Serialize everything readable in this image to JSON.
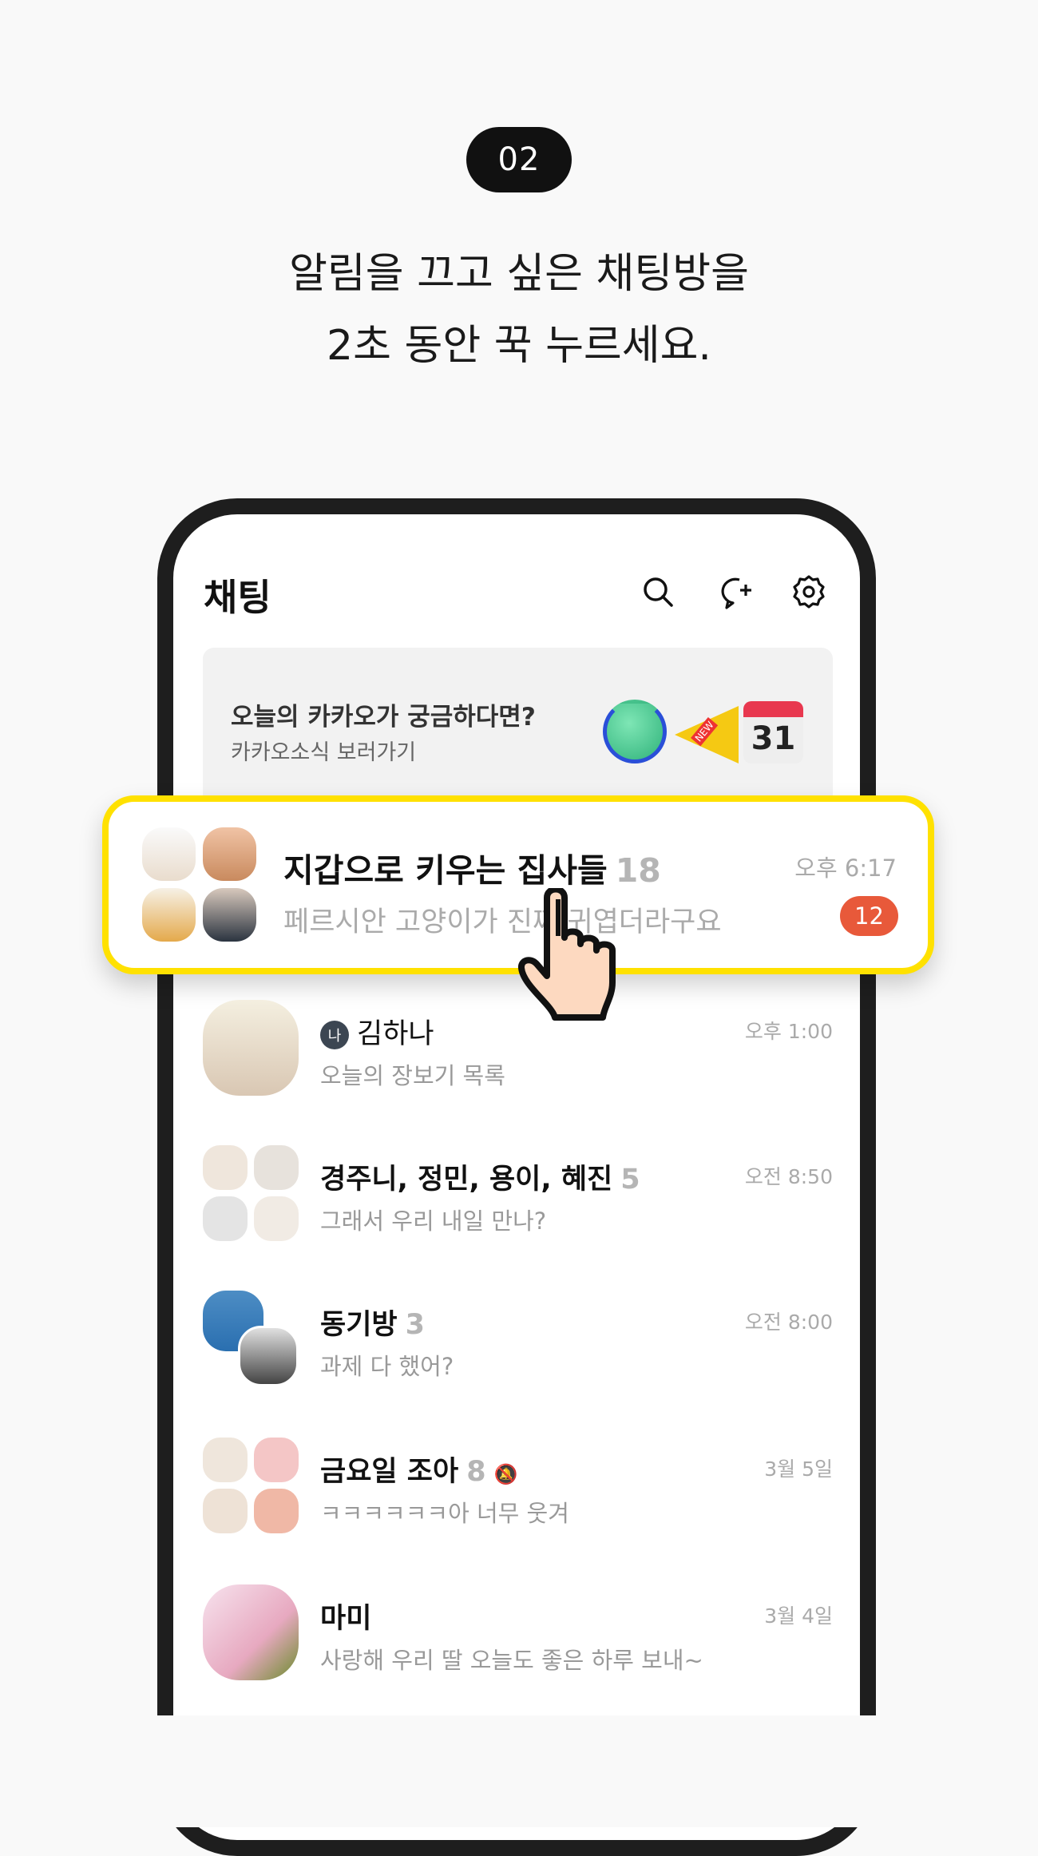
{
  "step": "02",
  "headline": [
    "알림을 끄고 싶은 채팅방을",
    "2초 동안 꾹 누르세요."
  ],
  "app": {
    "title": "채팅",
    "icons": [
      "search-icon",
      "new-chat-icon",
      "settings-icon"
    ]
  },
  "banner": {
    "title": "오늘의 카카오가 궁금하다면?",
    "subtitle": "카카오소식 보러가기",
    "calendar_day": "31",
    "megaphone_label": "NEW"
  },
  "highlighted": {
    "name": "지갑으로 키우는 집사들",
    "count": "18",
    "message": "페르시안 고양이가 진짜 귀엽더라구요",
    "time": "오후 6:17",
    "unread": "12"
  },
  "chats": [
    {
      "name": "김하나",
      "me_badge": "나",
      "count": "",
      "message": "오늘의 장보기 목록",
      "time": "오후 1:00"
    },
    {
      "name": "경주니, 정민, 용이, 혜진",
      "count": "5",
      "message": "그래서 우리 내일 만나?",
      "time": "오전 8:50"
    },
    {
      "name": "동기방",
      "count": "3",
      "message": "과제 다 했어?",
      "time": "오전 8:00"
    },
    {
      "name": "금요일 조아",
      "count": "8",
      "muted": true,
      "message": "ㅋㅋㅋㅋㅋㅋ아 너무 웃겨",
      "time": "3월 5일"
    },
    {
      "name": "마미",
      "count": "",
      "message": "사랑해 우리 딸 오늘도 좋은 하루 보내~",
      "time": "3월 4일"
    }
  ],
  "colors": {
    "highlight": "#ffe100",
    "unread": "#e8593a"
  }
}
